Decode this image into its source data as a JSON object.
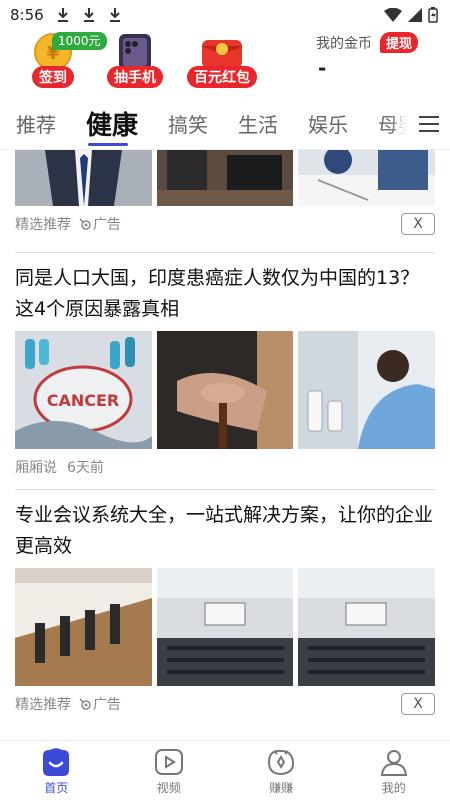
{
  "status_bar": {
    "time": "8:56",
    "download_icons": [
      "download-icon",
      "download-icon",
      "download-icon"
    ]
  },
  "top_bar": {
    "promos": [
      {
        "label": "签到",
        "badge": "1000元",
        "icon": "gold-coin-icon"
      },
      {
        "label": "抽手机",
        "icon": "phone-icon"
      },
      {
        "label": "百元红包",
        "icon": "red-envelope-icon"
      }
    ],
    "coins": {
      "title": "我的金币",
      "withdraw_label": "提现",
      "value": "-"
    }
  },
  "tabs": [
    "推荐",
    "健康",
    "搞笑",
    "生活",
    "娱乐",
    "母婴"
  ],
  "active_tab": 1,
  "feed": {
    "items": [
      {
        "source": "精选推荐",
        "ad_label": "广告",
        "close_label": "X"
      },
      {
        "title": "同是人口大国，印度患癌症人数仅为中国的13？这4个原因暴露真相",
        "source": "厢厢说",
        "time": "6天前",
        "thumb_text": "CANCER"
      },
      {
        "title": "专业会议系统大全，一站式解决方案，让你的企业更高效",
        "source": "精选推荐",
        "ad_label": "广告",
        "close_label": "X"
      }
    ]
  },
  "bottom_nav": [
    {
      "label": "首页",
      "icon": "home-icon",
      "active": true
    },
    {
      "label": "视频",
      "icon": "video-icon",
      "active": false
    },
    {
      "label": "赚赚",
      "icon": "earn-icon",
      "active": false
    },
    {
      "label": "我的",
      "icon": "profile-icon",
      "active": false
    }
  ],
  "colors": {
    "accent": "#3b4bd8",
    "promo_red": "#e8262b",
    "badge_green": "#2faa3f"
  }
}
